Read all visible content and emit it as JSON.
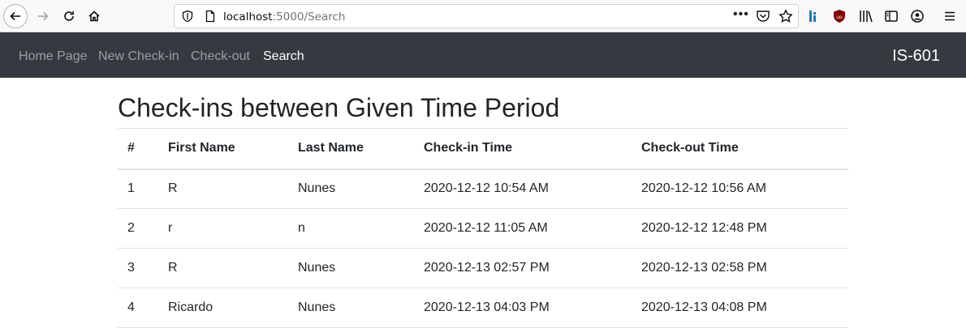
{
  "browser": {
    "url_host": "localhost",
    "url_path": ":5000/Search",
    "menu_dots": "•••",
    "icons": [
      "back-icon",
      "forward-icon",
      "reload-icon",
      "home-icon",
      "shield-icon",
      "page-icon",
      "pocket-icon",
      "star-icon",
      "extension-icon",
      "ublock-icon",
      "library-icon",
      "sidebar-icon",
      "account-icon",
      "menu-icon"
    ]
  },
  "navbar": {
    "links": [
      {
        "label": "Home Page",
        "active": false
      },
      {
        "label": "New Check-in",
        "active": false
      },
      {
        "label": "Check-out",
        "active": false
      },
      {
        "label": "Search",
        "active": true
      }
    ],
    "brand": "IS-601",
    "bg_color": "#343a40"
  },
  "main": {
    "title": "Check-ins between Given Time Period",
    "table": {
      "headers": [
        "#",
        "First Name",
        "Last Name",
        "Check-in Time",
        "Check-out Time"
      ],
      "rows": [
        [
          "1",
          "R",
          "Nunes",
          "2020-12-12 10:54 AM",
          "2020-12-12 10:56 AM"
        ],
        [
          "2",
          "r",
          "n",
          "2020-12-12 11:05 AM",
          "2020-12-12 12:48 PM"
        ],
        [
          "3",
          "R",
          "Nunes",
          "2020-12-13 02:57 PM",
          "2020-12-13 02:58 PM"
        ],
        [
          "4",
          "Ricardo",
          "Nunes",
          "2020-12-13 04:03 PM",
          "2020-12-13 04:08 PM"
        ]
      ]
    }
  }
}
